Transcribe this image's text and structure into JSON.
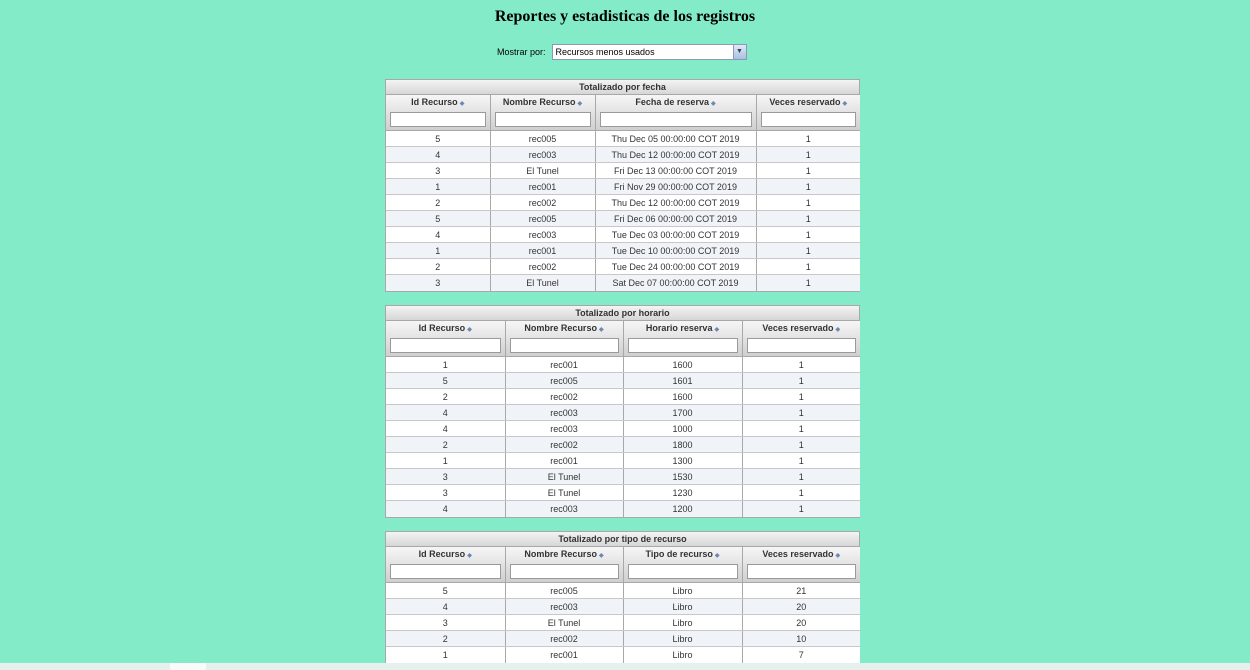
{
  "page_title": "Reportes y estadisticas de los registros",
  "filter": {
    "label": "Mostrar por:",
    "selected": "Recursos menos usados"
  },
  "tables": [
    {
      "title": "Totalizado por fecha",
      "columns": [
        "Id Recurso",
        "Nombre Recurso",
        "Fecha de reserva",
        "Veces reservado"
      ],
      "rows": [
        [
          "5",
          "rec005",
          "Thu Dec 05 00:00:00 COT 2019",
          "1"
        ],
        [
          "4",
          "rec003",
          "Thu Dec 12 00:00:00 COT 2019",
          "1"
        ],
        [
          "3",
          "El Tunel",
          "Fri Dec 13 00:00:00 COT 2019",
          "1"
        ],
        [
          "1",
          "rec001",
          "Fri Nov 29 00:00:00 COT 2019",
          "1"
        ],
        [
          "2",
          "rec002",
          "Thu Dec 12 00:00:00 COT 2019",
          "1"
        ],
        [
          "5",
          "rec005",
          "Fri Dec 06 00:00:00 COT 2019",
          "1"
        ],
        [
          "4",
          "rec003",
          "Tue Dec 03 00:00:00 COT 2019",
          "1"
        ],
        [
          "1",
          "rec001",
          "Tue Dec 10 00:00:00 COT 2019",
          "1"
        ],
        [
          "2",
          "rec002",
          "Tue Dec 24 00:00:00 COT 2019",
          "1"
        ],
        [
          "3",
          "El Tunel",
          "Sat Dec 07 00:00:00 COT 2019",
          "1"
        ]
      ]
    },
    {
      "title": "Totalizado por horario",
      "columns": [
        "Id Recurso",
        "Nombre Recurso",
        "Horario reserva",
        "Veces reservado"
      ],
      "rows": [
        [
          "1",
          "rec001",
          "1600",
          "1"
        ],
        [
          "5",
          "rec005",
          "1601",
          "1"
        ],
        [
          "2",
          "rec002",
          "1600",
          "1"
        ],
        [
          "4",
          "rec003",
          "1700",
          "1"
        ],
        [
          "4",
          "rec003",
          "1000",
          "1"
        ],
        [
          "2",
          "rec002",
          "1800",
          "1"
        ],
        [
          "1",
          "rec001",
          "1300",
          "1"
        ],
        [
          "3",
          "El Tunel",
          "1530",
          "1"
        ],
        [
          "3",
          "El Tunel",
          "1230",
          "1"
        ],
        [
          "4",
          "rec003",
          "1200",
          "1"
        ]
      ]
    },
    {
      "title": "Totalizado por tipo de recurso",
      "columns": [
        "Id Recurso",
        "Nombre Recurso",
        "Tipo de recurso",
        "Veces reservado"
      ],
      "rows": [
        [
          "5",
          "rec005",
          "Libro",
          "21"
        ],
        [
          "4",
          "rec003",
          "Libro",
          "20"
        ],
        [
          "3",
          "El Tunel",
          "Libro",
          "20"
        ],
        [
          "2",
          "rec002",
          "Libro",
          "10"
        ],
        [
          "1",
          "rec001",
          "Libro",
          "7"
        ]
      ]
    }
  ],
  "icons": {
    "sort": "sort-icon",
    "dropdown": "dropdown-arrow-icon"
  }
}
